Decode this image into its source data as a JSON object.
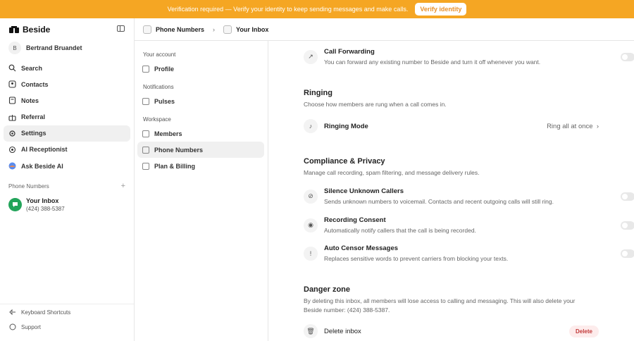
{
  "banner": {
    "text": "Verification required — Verify your identity to keep sending messages and make calls.",
    "button": "Verify identity"
  },
  "sidebar": {
    "logo": "Beside",
    "user": {
      "initial": "B",
      "name": "Bertrand Bruandet"
    },
    "items": [
      {
        "label": "Search",
        "icon": "search-icon"
      },
      {
        "label": "Contacts",
        "icon": "contacts-icon"
      },
      {
        "label": "Notes",
        "icon": "notes-icon"
      },
      {
        "label": "Referral",
        "icon": "referral-icon"
      },
      {
        "label": "Settings",
        "icon": "settings-icon"
      },
      {
        "label": "AI Receptionist",
        "icon": "ai-receptionist-icon"
      },
      {
        "label": "Ask Beside AI",
        "icon": "beside-ai-icon"
      }
    ],
    "phone_numbers_label": "Phone Numbers",
    "inbox": {
      "name": "Your Inbox",
      "phone": "(424) 388-5387"
    },
    "bottom": [
      {
        "label": "Keyboard Shortcuts"
      },
      {
        "label": "Support"
      }
    ]
  },
  "header": {
    "crumbs": [
      "Phone Numbers",
      "Your Inbox"
    ]
  },
  "settings_nav": {
    "account_label": "Your account",
    "profile": "Profile",
    "notifications_label": "Notifications",
    "pulses": "Pulses",
    "workspace_label": "Workspace",
    "members": "Members",
    "phone_numbers": "Phone Numbers",
    "billing": "Plan & Billing"
  },
  "content": {
    "call_forwarding": {
      "title": "Call Forwarding",
      "desc": "You can forward any existing number to Beside and turn it off whenever you want."
    },
    "ringing": {
      "title": "Ringing",
      "desc": "Choose how members are rung when a call comes in.",
      "mode_label": "Ringing Mode",
      "mode_value": "Ring all at once"
    },
    "compliance": {
      "title": "Compliance & Privacy",
      "desc": "Manage call recording, spam filtering, and message delivery rules.",
      "items": [
        {
          "title": "Silence Unknown Callers",
          "desc": "Sends unknown numbers to voicemail. Contacts and recent outgoing calls will still ring."
        },
        {
          "title": "Recording Consent",
          "desc": "Automatically notify callers that the call is being recorded."
        },
        {
          "title": "Auto Censor Messages",
          "desc": "Replaces sensitive words to prevent carriers from blocking your texts."
        }
      ]
    },
    "danger": {
      "title": "Danger zone",
      "desc": "By deleting this inbox, all members will lose access to calling and messaging. This will also delete your Beside number: (424) 388-5387.",
      "delete_label": "Delete inbox",
      "delete_button": "Delete"
    }
  }
}
